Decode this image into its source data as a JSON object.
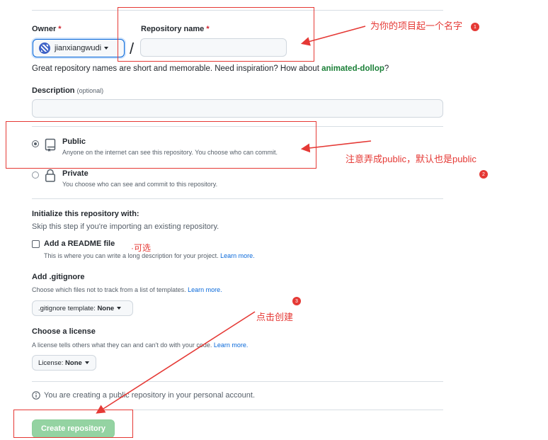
{
  "owner": {
    "label": "Owner",
    "required_mark": "*",
    "value": "jianxiangwudi"
  },
  "repo": {
    "label": "Repository name",
    "required_mark": "*",
    "value": ""
  },
  "separator": "/",
  "hint": {
    "text": "Great repository names are short and memorable. Need inspiration? How about ",
    "suggestion": "animated-dollop",
    "end": "?"
  },
  "description": {
    "label": "Description",
    "optional": "(optional)",
    "value": ""
  },
  "visibility": {
    "public": {
      "title": "Public",
      "desc": "Anyone on the internet can see this repository. You choose who can commit.",
      "checked": true
    },
    "private": {
      "title": "Private",
      "desc": "You choose who can see and commit to this repository.",
      "checked": false
    }
  },
  "init": {
    "heading": "Initialize this repository with:",
    "subtext": "Skip this step if you're importing an existing repository."
  },
  "readme": {
    "label": "Add a README file",
    "desc": "This is where you can write a long description for your project.",
    "learn": "Learn more."
  },
  "gitignore": {
    "heading": "Add .gitignore",
    "desc": "Choose which files not to track from a list of templates.",
    "learn": "Learn more.",
    "select_prefix": ".gitignore template:",
    "select_value": "None"
  },
  "license": {
    "heading": "Choose a license",
    "desc": "A license tells others what they can and can't do with your code.",
    "learn": "Learn more.",
    "select_prefix": "License:",
    "select_value": "None"
  },
  "notice": "You are creating a public repository in your personal account.",
  "create_button": "Create repository",
  "annotations": {
    "name_repo": "为你的项目起一个名字",
    "public_note": "注意弄成public，默认也是public",
    "optional": "可选",
    "click_create": "点击创建",
    "badge1": "1",
    "badge2": "2",
    "badge3": "3"
  },
  "colors": {
    "annotation": "#e53935",
    "link": "#0969da",
    "suggestion": "#1a7f37",
    "button": "#94d3a2"
  }
}
